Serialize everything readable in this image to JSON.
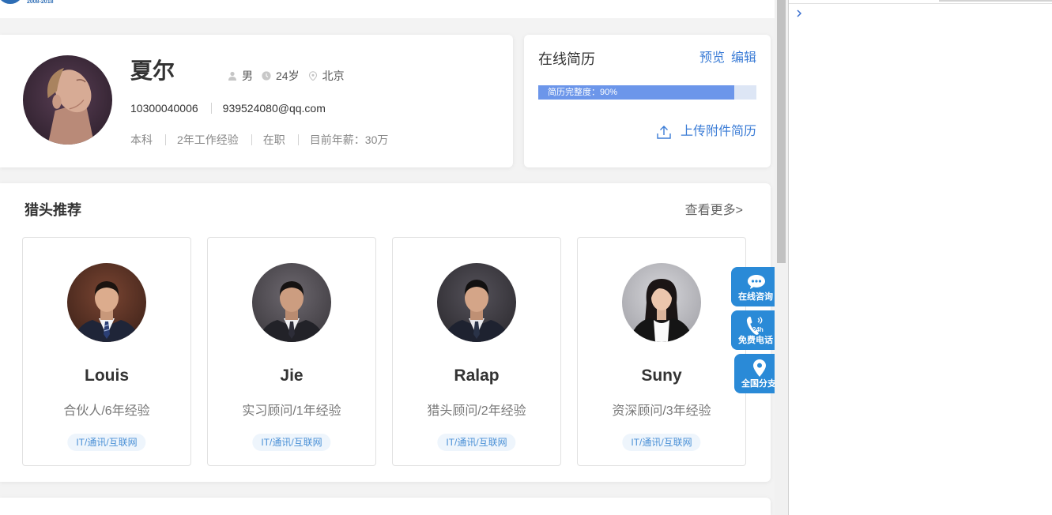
{
  "header": {
    "logo_years": "2008-2018"
  },
  "profile": {
    "name": "夏尔",
    "gender": "男",
    "age": "24岁",
    "city": "北京",
    "phone": "10300040006",
    "email": "939524080@qq.com",
    "education": "本科",
    "experience": "2年工作经验",
    "status": "在职",
    "salary": "目前年薪：30万"
  },
  "resume": {
    "title": "在线简历",
    "preview_label": "预览",
    "edit_label": "编辑",
    "completeness_text": "简历完整度：90%",
    "completeness_percent": 90,
    "upload_label": "上传附件简历"
  },
  "headhunters": {
    "title": "猎头推荐",
    "more_label": "查看更多>",
    "items": [
      {
        "name": "Louis",
        "role": "合伙人/6年经验",
        "industry": "IT/通讯/互联网"
      },
      {
        "name": "Jie",
        "role": "实习顾问/1年经验",
        "industry": "IT/通讯/互联网"
      },
      {
        "name": "Ralap",
        "role": "猎头顾问/2年经验",
        "industry": "IT/通讯/互联网"
      },
      {
        "name": "Suny",
        "role": "资深顾问/3年经验",
        "industry": "IT/通讯/互联网"
      }
    ]
  },
  "float_buttons": [
    {
      "label": "在线咨询",
      "icon": "chat-icon"
    },
    {
      "label": "免费电话",
      "icon": "phone-24h-icon",
      "badge": "24h"
    },
    {
      "label": "全国分支",
      "icon": "location-pin-icon"
    }
  ],
  "theme": {
    "accent": "#3b7cd6",
    "float_button_bg": "#2a8ad7",
    "progress_fill": "#6c96ea",
    "progress_track": "#dde6f5"
  }
}
